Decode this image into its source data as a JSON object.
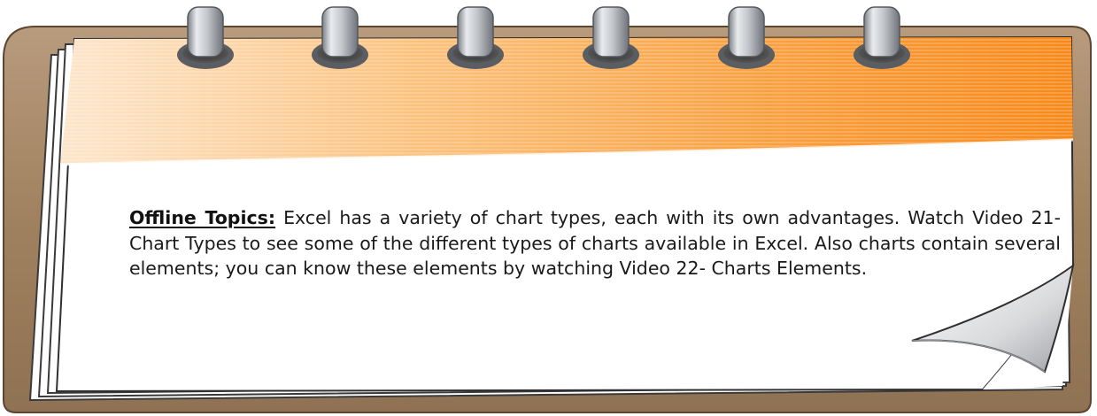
{
  "note": {
    "heading": "Offline Topics:",
    "body": " Excel has a variety of chart types, each with its own advantages. Watch Video 21- Chart Types to see some of the different types of charts available in Excel. Also charts contain several elements; you can know these elements by watching Video 22- Charts Elements."
  },
  "colors": {
    "board_frame": "#a8896a",
    "header_orange": "#f7931e",
    "header_light": "#fbbf80",
    "paper": "#ffffff",
    "ring_metal": "#b9bcc0"
  },
  "decor": {
    "rings": 6,
    "ring_icon": "binder-ring-icon",
    "curl_icon": "page-curl-icon"
  }
}
